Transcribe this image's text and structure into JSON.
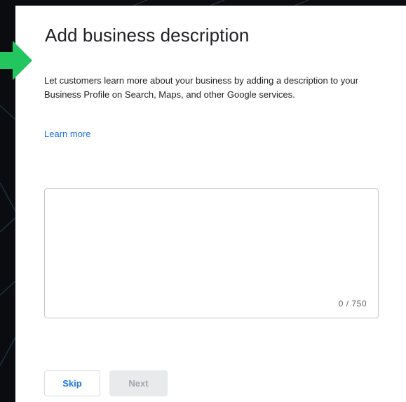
{
  "dialog": {
    "title": "Add business description",
    "description": "Let customers learn more about your business by adding a description to your Business Profile on Search, Maps, and other Google services.",
    "learn_more_label": "Learn more",
    "textarea": {
      "value": "",
      "char_count": "0 / 750"
    },
    "buttons": {
      "skip_label": "Skip",
      "next_label": "Next"
    }
  },
  "colors": {
    "background": "#0b0c10",
    "card": "#ffffff",
    "link": "#1a73e8",
    "arrow": "#22c55e",
    "disabled_button": "#e9eaeb"
  },
  "icons": {
    "pointer": "green-arrow-icon"
  }
}
